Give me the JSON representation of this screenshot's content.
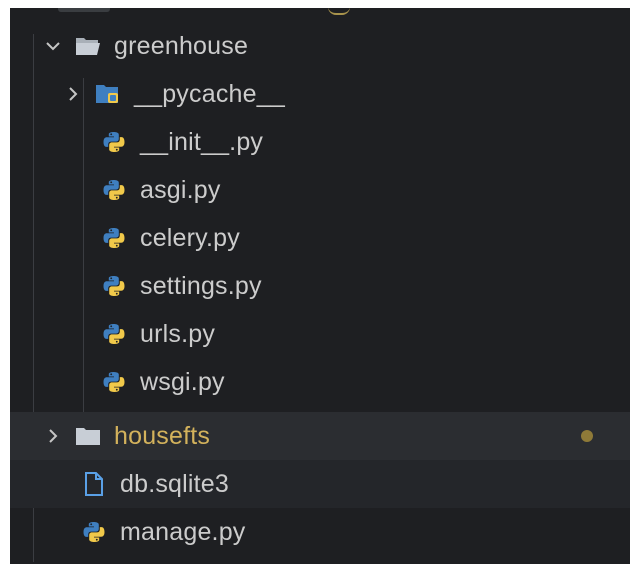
{
  "explorer": {
    "items": [
      {
        "label": "greenhouse",
        "kind": "folder",
        "expanded": true,
        "icon": "folder-open-icon"
      },
      {
        "label": "__pycache__",
        "kind": "folder",
        "expanded": false,
        "icon": "pycache-folder-icon"
      },
      {
        "label": "__init__.py",
        "kind": "python-file",
        "icon": "python-icon"
      },
      {
        "label": "asgi.py",
        "kind": "python-file",
        "icon": "python-icon"
      },
      {
        "label": "celery.py",
        "kind": "python-file",
        "icon": "python-icon"
      },
      {
        "label": "settings.py",
        "kind": "python-file",
        "icon": "python-icon"
      },
      {
        "label": "urls.py",
        "kind": "python-file",
        "icon": "python-icon"
      },
      {
        "label": "wsgi.py",
        "kind": "python-file",
        "icon": "python-icon"
      },
      {
        "label": "housefts",
        "kind": "folder",
        "expanded": false,
        "modified": true,
        "icon": "folder-icon"
      },
      {
        "label": "db.sqlite3",
        "kind": "file",
        "icon": "file-icon"
      },
      {
        "label": "manage.py",
        "kind": "python-file",
        "icon": "python-icon"
      }
    ]
  },
  "colors": {
    "background": "#1e1f22",
    "text": "#cccccc",
    "modified_text": "#d3b25c",
    "modified_dot": "#8f7a38",
    "selected_row": "#2b2d31",
    "python_blue": "#3f7fc0",
    "python_yellow": "#f1c94a"
  }
}
